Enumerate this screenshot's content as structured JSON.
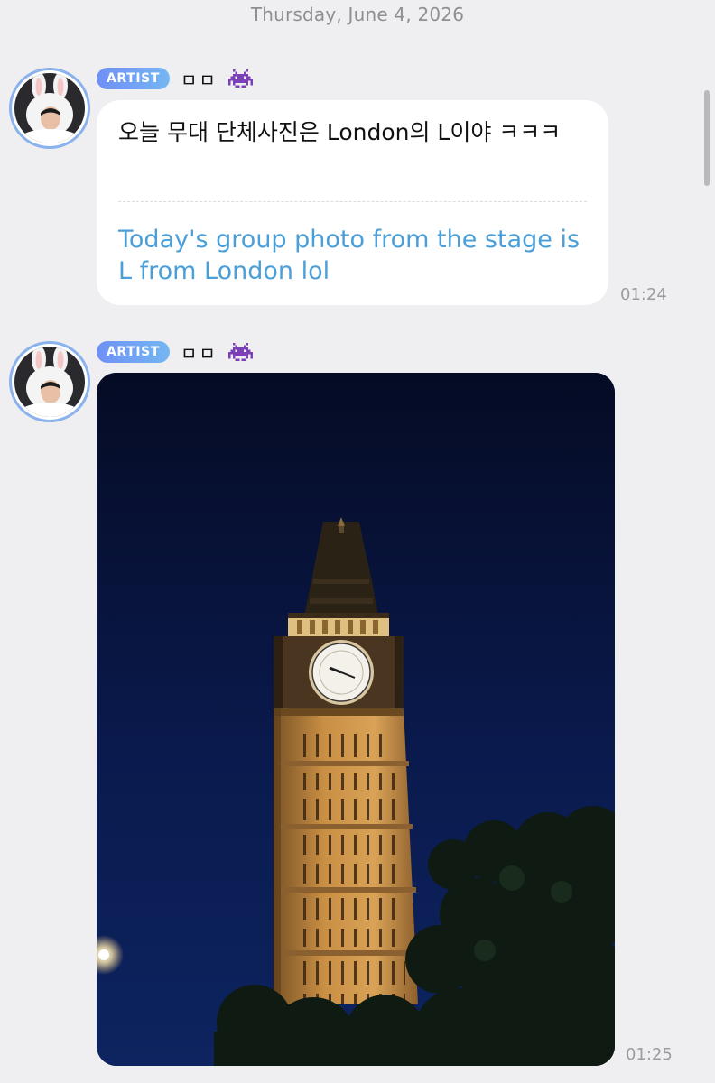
{
  "date_separator": "Thursday, June 4, 2026",
  "messages": [
    {
      "badge": "ARTIST",
      "sender": "ㅁㅁ",
      "sender_icon": "alien-monster-icon",
      "original": "오늘 무대 단체사진은 London의 L이야 ㅋㅋㅋ",
      "translation": "Today's group photo from the stage is L from London lol",
      "time": "01:24"
    },
    {
      "badge": "ARTIST",
      "sender": "ㅁㅁ",
      "sender_icon": "alien-monster-icon",
      "photo": "big-ben-night-photo",
      "time": "01:25"
    }
  ],
  "colors": {
    "background": "#efeff1",
    "badge_start": "#6f90f5",
    "badge_end": "#74b6f2",
    "translation_text": "#4a9fd8",
    "avatar_ring": "#8ab2ec",
    "alien_icon": "#7b3fb8"
  }
}
